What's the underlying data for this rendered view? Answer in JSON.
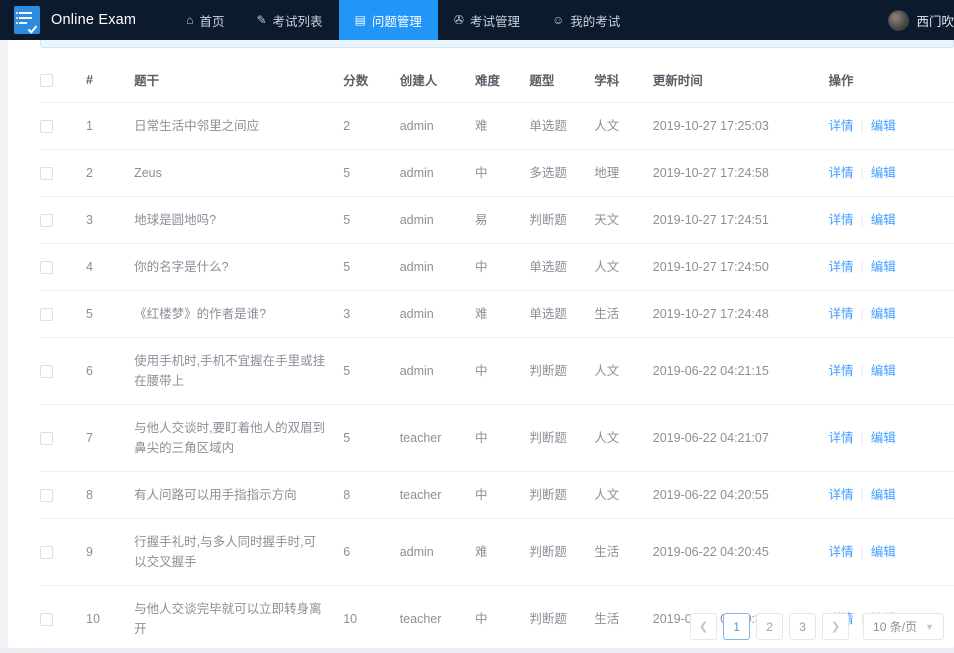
{
  "header": {
    "brand": "Online Exam",
    "brand_logo_icon": "checklist-icon",
    "nav": [
      {
        "label": "首页",
        "icon": "home-icon",
        "active": false
      },
      {
        "label": "考试列表",
        "icon": "pen-icon",
        "active": false
      },
      {
        "label": "问题管理",
        "icon": "document-icon",
        "active": true
      },
      {
        "label": "考试管理",
        "icon": "mouse-icon",
        "active": false
      },
      {
        "label": "我的考试",
        "icon": "user-icon",
        "active": false
      }
    ],
    "user": {
      "name": "西门吹",
      "avatar_icon": "avatar"
    },
    "active_bg": "#2196f7",
    "bar_bg": "#0b1a2d"
  },
  "table": {
    "select_all_icon": "checkbox-icon",
    "columns": {
      "num": "#",
      "title": "题干",
      "score": "分数",
      "author": "创建人",
      "difficulty": "难度",
      "type": "题型",
      "subject": "学科",
      "updated": "更新时间",
      "ops": "操作"
    },
    "op_detail": "详情",
    "op_edit": "编辑",
    "rows": [
      {
        "num": "1",
        "title": "日常生活中邻里之间应",
        "score": "2",
        "author": "admin",
        "difficulty": "难",
        "type": "单选题",
        "subject": "人文",
        "updated": "2019-10-27 17:25:03"
      },
      {
        "num": "2",
        "title": "Zeus",
        "score": "5",
        "author": "admin",
        "difficulty": "中",
        "type": "多选题",
        "subject": "地理",
        "updated": "2019-10-27 17:24:58"
      },
      {
        "num": "3",
        "title": "地球是圆地吗?",
        "score": "5",
        "author": "admin",
        "difficulty": "易",
        "type": "判断题",
        "subject": "天文",
        "updated": "2019-10-27 17:24:51"
      },
      {
        "num": "4",
        "title": "你的名字是什么?",
        "score": "5",
        "author": "admin",
        "difficulty": "中",
        "type": "单选题",
        "subject": "人文",
        "updated": "2019-10-27 17:24:50"
      },
      {
        "num": "5",
        "title": "《红楼梦》的作者是谁?",
        "score": "3",
        "author": "admin",
        "difficulty": "难",
        "type": "单选题",
        "subject": "生活",
        "updated": "2019-10-27 17:24:48"
      },
      {
        "num": "6",
        "title": "使用手机时,手机不宜握在手里或挂在腰带上",
        "score": "5",
        "author": "admin",
        "difficulty": "中",
        "type": "判断题",
        "subject": "人文",
        "updated": "2019-06-22 04:21:15"
      },
      {
        "num": "7",
        "title": "与他人交谈时,要盯着他人的双眉到鼻尖的三角区域内",
        "score": "5",
        "author": "teacher",
        "difficulty": "中",
        "type": "判断题",
        "subject": "人文",
        "updated": "2019-06-22 04:21:07"
      },
      {
        "num": "8",
        "title": "有人问路可以用手指指示方向",
        "score": "8",
        "author": "teacher",
        "difficulty": "中",
        "type": "判断题",
        "subject": "人文",
        "updated": "2019-06-22 04:20:55"
      },
      {
        "num": "9",
        "title": "行握手礼时,与多人同时握手时,可以交叉握手",
        "score": "6",
        "author": "admin",
        "difficulty": "难",
        "type": "判断题",
        "subject": "生活",
        "updated": "2019-06-22 04:20:45"
      },
      {
        "num": "10",
        "title": "与他人交谈完毕就可以立即转身离开",
        "score": "10",
        "author": "teacher",
        "difficulty": "中",
        "type": "判断题",
        "subject": "生活",
        "updated": "2019-06-22 04:20:33"
      }
    ]
  },
  "pagination": {
    "prev_icon": "chevron-left-icon",
    "next_icon": "chevron-right-icon",
    "pages": [
      "1",
      "2",
      "3"
    ],
    "current": "1",
    "page_size_label": "10 条/页",
    "caret_icon": "chevron-down-icon"
  },
  "colors": {
    "accent": "#409eff",
    "header_bg": "#0b1a2d",
    "active_tab": "#2196f7"
  }
}
